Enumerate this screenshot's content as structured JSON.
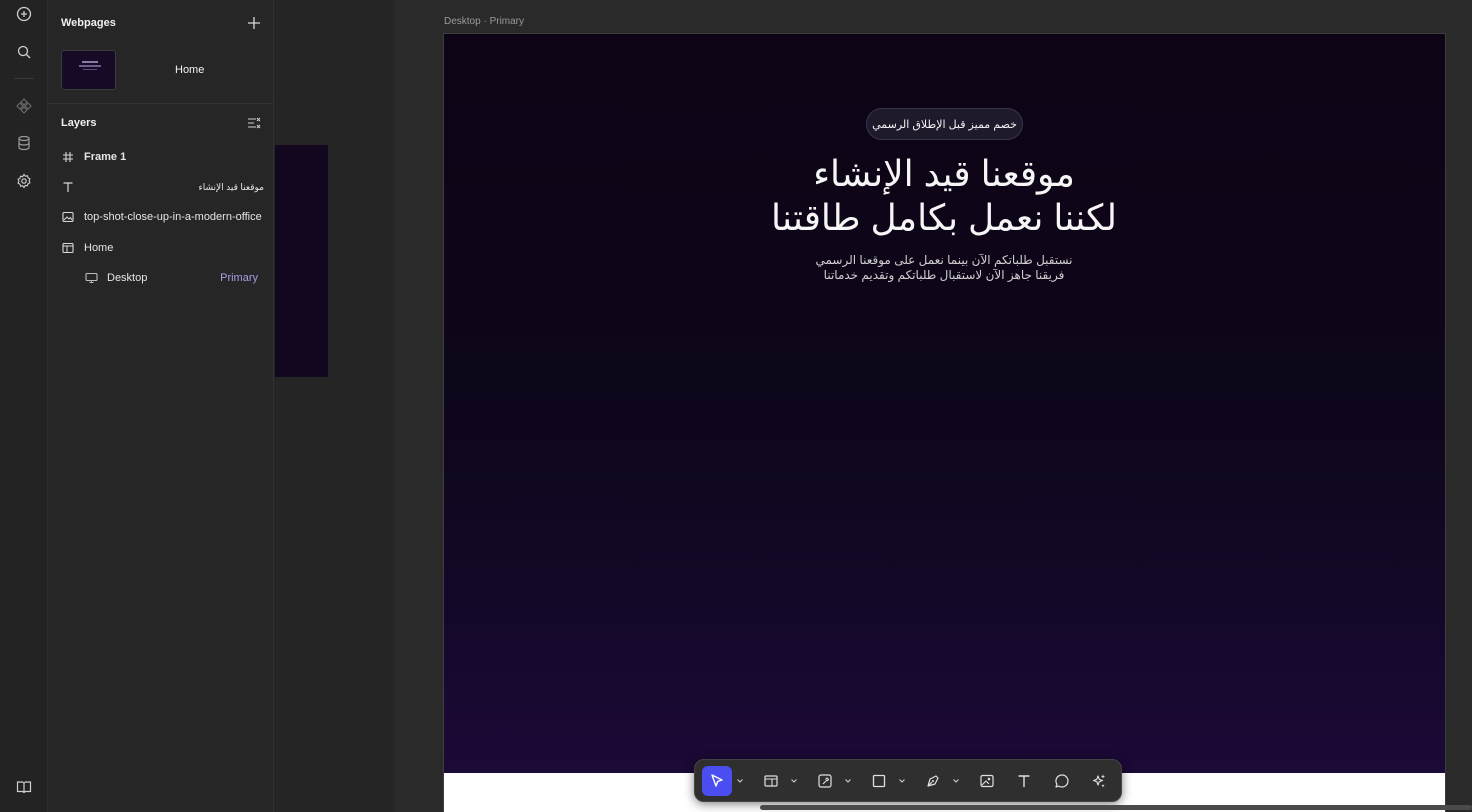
{
  "rail": {
    "icons": [
      "add-icon",
      "search-icon",
      "components-icon",
      "database-icon",
      "settings-icon",
      "docs-icon"
    ]
  },
  "webpages": {
    "title": "Webpages",
    "pages": [
      {
        "name": "Home"
      }
    ]
  },
  "layers": {
    "title": "Layers",
    "items": [
      {
        "label": "Frame 1",
        "icon": "frame-icon"
      },
      {
        "label": "موقعنا قيد الإنشاء",
        "icon": "text-icon"
      },
      {
        "label": "top-shot-close-up-in-a-modern-office",
        "icon": "image-icon"
      },
      {
        "label": "Home",
        "icon": "page-icon"
      },
      {
        "label": "Desktop",
        "icon": "desktop-icon",
        "tag": "Primary"
      }
    ]
  },
  "canvas": {
    "frame_label": "Desktop · Primary",
    "badge": "خصم مميز قبل الإطلاق الرسمي",
    "headline_line1": "موقعنا قيد الإنشاء",
    "headline_line2": "لكننا نعمل بكامل طاقتنا",
    "subline_line1": "نستقبل طلباتكم الآن بينما نعمل على موقعنا الرسمي",
    "subline_line2": "فريقنا جاهز الآن لاستقبال طلباتكم وتقديم خدماتنا"
  },
  "toolbar": {
    "tools": [
      "select-tool-icon",
      "layout-tool-icon",
      "component-tool-icon",
      "shape-tool-icon",
      "pen-tool-icon",
      "image-tool-icon",
      "text-tool-icon",
      "comment-tool-icon",
      "ai-tool-icon"
    ],
    "active_color": "#4a4df0"
  },
  "colors": {
    "accent": "#4a4df0",
    "tag": "#a89be6",
    "frame_bg_top": "#0d0516",
    "frame_bg_bottom": "#1e0a3a"
  }
}
